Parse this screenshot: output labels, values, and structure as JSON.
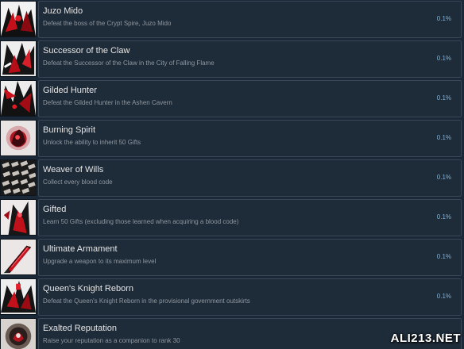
{
  "achievements": [
    {
      "title": "Juzo Mido",
      "description": "Defeat the boss of the Crypt Spire, Juzo Mido",
      "percent": "0.1%",
      "icon": "juzo-mido-icon"
    },
    {
      "title": "Successor of the Claw",
      "description": "Defeat the Successor of the Claw in the City of Falling Flame",
      "percent": "0.1%",
      "icon": "successor-claw-icon"
    },
    {
      "title": "Gilded Hunter",
      "description": "Defeat the Gilded Hunter in the Ashen Cavern",
      "percent": "0.1%",
      "icon": "gilded-hunter-icon"
    },
    {
      "title": "Burning Spirit",
      "description": "Unlock the ability to inherit 50 Gifts",
      "percent": "0.1%",
      "icon": "burning-spirit-icon"
    },
    {
      "title": "Weaver of Wills",
      "description": "Collect every blood code",
      "percent": "0.1%",
      "icon": "weaver-wills-icon"
    },
    {
      "title": "Gifted",
      "description": "Learn 50 Gifts (excluding those learned when acquiring a blood code)",
      "percent": "0.1%",
      "icon": "gifted-icon"
    },
    {
      "title": "Ultimate Armament",
      "description": "Upgrade a weapon to its maximum level",
      "percent": "0.1%",
      "icon": "ultimate-armament-icon"
    },
    {
      "title": "Queen's Knight Reborn",
      "description": "Defeat the Queen's Knight Reborn in the provisional government outskirts",
      "percent": "0.1%",
      "icon": "queens-knight-icon"
    },
    {
      "title": "Exalted Reputation",
      "description": "Raise your reputation as a companion to rank 30",
      "percent": "0.1%",
      "icon": "exalted-reputation-icon"
    }
  ],
  "watermark": "ALI213.NET",
  "colors": {
    "background": "#1b2838",
    "panel": "#1e2b39",
    "percent": "#7fb5d9",
    "accent_red": "#c0101a"
  }
}
